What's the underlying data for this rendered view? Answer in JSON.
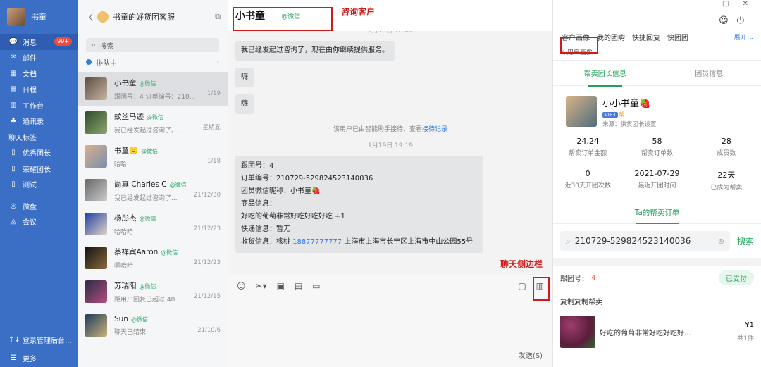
{
  "me": {
    "name": "书童"
  },
  "nav": {
    "items": [
      {
        "icon": "💬",
        "label": "消息",
        "badge": "99+"
      },
      {
        "icon": "✉",
        "label": "邮件"
      },
      {
        "icon": "▦",
        "label": "文档"
      },
      {
        "icon": "▤",
        "label": "日程"
      },
      {
        "icon": "▥",
        "label": "工作台"
      },
      {
        "icon": "♣",
        "label": "通讯录"
      }
    ],
    "section": "聊天标签",
    "tags": [
      {
        "icon": "▯",
        "label": "优秀团长"
      },
      {
        "icon": "▯",
        "label": "荣耀团长"
      },
      {
        "icon": "▯",
        "label": "测试"
      }
    ],
    "apps": [
      {
        "icon": "◎",
        "label": "微盘"
      },
      {
        "icon": "◬",
        "label": "会议"
      }
    ],
    "bottom": [
      {
        "icon": "↑↓",
        "label": "登录管理后台..."
      },
      {
        "icon": "☰",
        "label": "更多"
      }
    ]
  },
  "mid": {
    "title": "书童的好货团客服",
    "search_placeholder": "搜索",
    "queue": "排队中",
    "conversations": [
      {
        "name": "小书童",
        "tag": "@微信",
        "preview": "跟团号：4 订单编号：210...",
        "time": "1/19",
        "selected": true,
        "c1": "#5a4c43",
        "c2": "#c9b6a3"
      },
      {
        "name": "蚊丝马迹",
        "tag": "@微信",
        "preview": "我已经发起过咨询了。...",
        "time": "星期五",
        "c1": "#2f4b2a",
        "c2": "#8da56e"
      },
      {
        "name": "书童🙂",
        "tag": "@微信",
        "preview": "哈哈",
        "time": "1/18",
        "c1": "#d8b08c",
        "c2": "#7a8fb0"
      },
      {
        "name": "尚真 Charles C",
        "tag": "@微信",
        "preview": "我已经发起过咨询了...",
        "time": "21/12/30",
        "c1": "#666",
        "c2": "#ccc"
      },
      {
        "name": "杨彤杰",
        "tag": "@微信",
        "preview": "哈哈哈",
        "time": "21/12/23",
        "c1": "#1f3ea0",
        "c2": "#e0d5c9"
      },
      {
        "name": "蔡祥宾Aaron",
        "tag": "@微信",
        "preview": "啊哈哈",
        "time": "21/12/23",
        "c1": "#111",
        "c2": "#8a6a3c"
      },
      {
        "name": "苏瑞阳",
        "tag": "@微信",
        "preview": "距用户回复已超过 48 ...",
        "time": "21/12/15",
        "c1": "#2a2a4a",
        "c2": "#b44e7a"
      },
      {
        "name": "Sun",
        "tag": "@微信",
        "preview": "聊天已结束",
        "time": "21/10/6",
        "c1": "#1c3a5a",
        "c2": "#c8b27a"
      }
    ]
  },
  "chat": {
    "title": "小书童",
    "title_mark": "□",
    "tag": "@微信",
    "annotation_customer": "咨询客户",
    "annotation_sidebar": "聊天侧边栏",
    "time1": "1月19日 18:07",
    "msg1": "我已经发起过咨询了，现在由你继续提供服务。",
    "msg2": "嗨",
    "msg3": "嗨",
    "sys_text": "该用户已由智能助手接待，查看",
    "sys_link": "接待记录",
    "time2": "1月19日 19:19",
    "order_lines": {
      "l1": "跟团号：4",
      "l2": "订单编号：210729-529824523140036",
      "l3": "团员微信昵称：小书童🍓",
      "l4": "商品信息：",
      "l5": "好吃的葡萄非常好吃好吃好吃 +1",
      "l6": "快递信息：暂无",
      "l7a": "收货信息：核桃 ",
      "phone": "18877777777",
      "l7b": " 上海市上海市长宁区上海市中山公园55号"
    },
    "send": "发送(S)"
  },
  "side": {
    "window_controls": "–  □  ✕",
    "tabs": [
      "客户画像",
      "我的团购",
      "快捷回复",
      "快团团"
    ],
    "expand": "展开 ⌄",
    "crumb": "〈 用户画像",
    "subtab_on": "帮卖团长信息",
    "subtab_off": "团员信息",
    "profile": {
      "name": "小小书童🍓",
      "vip": "VIP3",
      "star": "帮",
      "source": "来源：供货团长设置"
    },
    "stats": [
      {
        "v": "24.24",
        "l": "帮卖订单金额"
      },
      {
        "v": "58",
        "l": "帮卖订单数"
      },
      {
        "v": "28",
        "l": "成员数"
      },
      {
        "v": "0",
        "l": "近30天开团次数"
      },
      {
        "v": "2021-07-29",
        "l": "最近开团时间"
      },
      {
        "v": "22天",
        "l": "已成为帮卖"
      }
    ],
    "ta_tab": "Ta的帮卖订单",
    "query": "210729-529824523140036",
    "search_btn": "搜索",
    "order_label": "跟团号：",
    "order_num": "4",
    "paid": "已支付",
    "copy_title": "复制复制帮卖",
    "goods_name": "好吃的葡萄非常好吃好吃好...",
    "price": "¥1",
    "count": "共1件"
  }
}
